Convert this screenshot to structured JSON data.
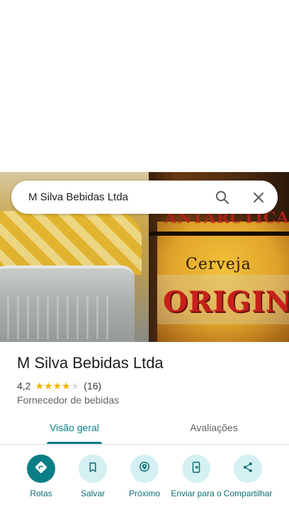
{
  "search": {
    "query": "M Silva Bebidas Ltda",
    "search_icon": "search-icon",
    "close_icon": "close-icon"
  },
  "photo": {
    "brand_text_top": "ANTARCTICA",
    "brand_text_mid": "Cerveja",
    "brand_text_main": "ORIGINAL"
  },
  "place": {
    "name": "M Silva Bebidas Ltda",
    "rating": "4,2",
    "rating_value": 4.2,
    "stars_filled": 4,
    "stars_total": 5,
    "review_count": "(16)",
    "category": "Fornecedor de bebidas"
  },
  "tabs": [
    {
      "label": "Visão geral",
      "active": true
    },
    {
      "label": "Avaliações",
      "active": false
    }
  ],
  "actions": [
    {
      "label": "Rotas",
      "icon": "directions-icon"
    },
    {
      "label": "Salvar",
      "icon": "bookmark-icon"
    },
    {
      "label": "Próximo",
      "icon": "nearby-icon"
    },
    {
      "label": "Enviar para o",
      "icon": "send-to-phone-icon"
    },
    {
      "label": "Compartilhar",
      "icon": "share-icon"
    }
  ],
  "colors": {
    "accent": "#0b7f86",
    "action_bg": "#d5f0f2",
    "star": "#f6b400",
    "star_empty": "#dadce0"
  }
}
